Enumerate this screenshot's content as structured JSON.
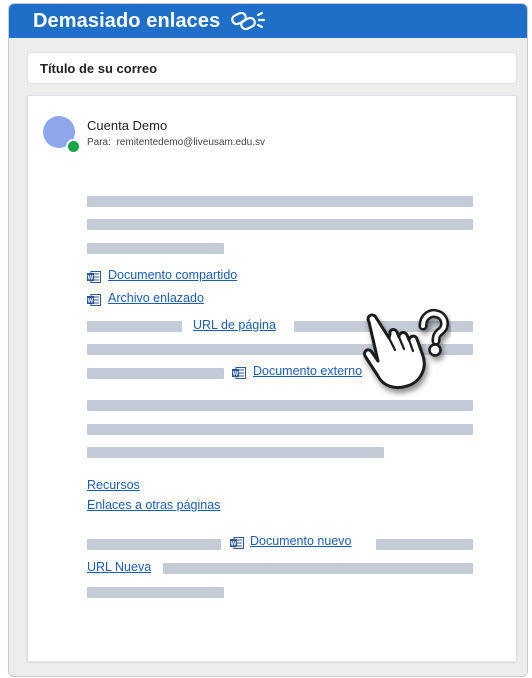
{
  "header": {
    "title": "Demasiado enlaces",
    "icon": "broken-link-icon",
    "color": "#1f6ec7"
  },
  "email": {
    "subject": "Título de su correo",
    "sender": {
      "name": "Cuenta Demo",
      "to_label": "Para:",
      "to_address": "remitentedemo@liveusam.edu.sv",
      "avatar_color": "#8ea7eb",
      "status_color": "#17a34a"
    },
    "links": {
      "documento_compartido": "Documento compartido",
      "archivo_enlazado": "Archivo enlazado",
      "url_pagina": "URL de página",
      "documento_externo": "Documento externo",
      "recursos": "Recursos",
      "enlaces_otras_paginas": "Enlaces a otras páginas",
      "documento_nuevo": "Documento nuevo",
      "url_nueva": "URL Nueva"
    },
    "link_color": "#1a5db5",
    "placeholder_color": "#c5cbd6"
  },
  "overlay": {
    "icon": "pointing-hand-question-icon"
  }
}
